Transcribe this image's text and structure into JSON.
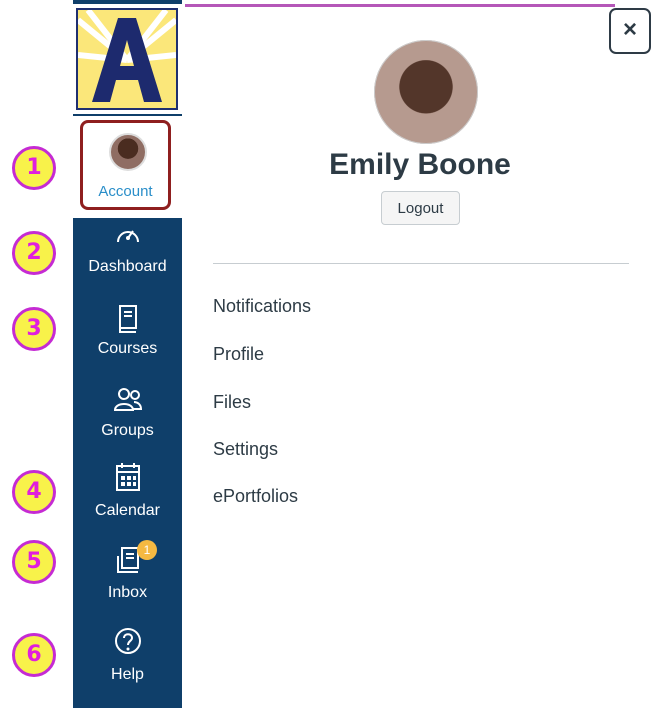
{
  "sidebar": {
    "account_label": "Account",
    "items": [
      {
        "label": "Dashboard",
        "icon": "dashboard-icon"
      },
      {
        "label": "Courses",
        "icon": "book-icon"
      },
      {
        "label": "Groups",
        "icon": "groups-icon"
      },
      {
        "label": "Calendar",
        "icon": "calendar-icon"
      },
      {
        "label": "Inbox",
        "icon": "inbox-icon",
        "badge": "1"
      },
      {
        "label": "Help",
        "icon": "help-icon"
      }
    ]
  },
  "account": {
    "name": "Emily Boone",
    "logout_label": "Logout",
    "close_label": "×",
    "links": [
      "Notifications",
      "Profile",
      "Files",
      "Settings",
      "ePortfolios"
    ]
  },
  "callouts": [
    "1",
    "2",
    "3",
    "4",
    "5",
    "6"
  ],
  "colors": {
    "sidebar_bg": "#0f3f6a",
    "accent": "#2a8ec9",
    "badge": "#f5b942",
    "bubble_fill": "#f8f24a",
    "bubble_text": "#e01fde",
    "account_border": "#8f1f1f"
  }
}
